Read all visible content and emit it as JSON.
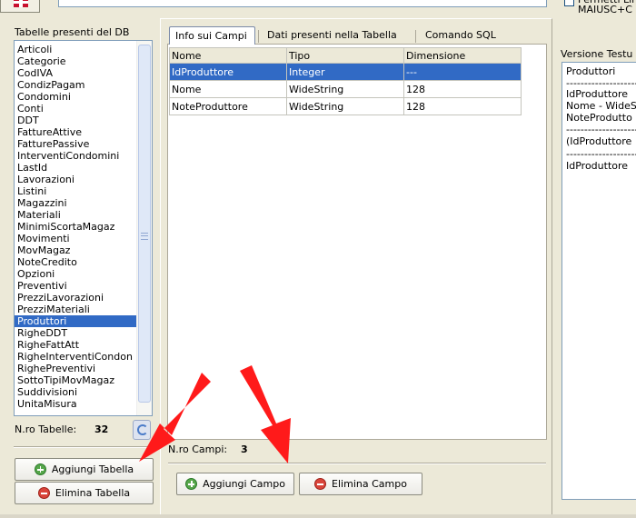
{
  "top": {
    "flag_icon": "uk-flag-icon",
    "perm_label": "Permetti Lin\nMAIUSC+C"
  },
  "tables_panel": {
    "label": "Tabelle presenti del DB",
    "items": [
      "Articoli",
      "Categorie",
      "CodIVA",
      "CondizPagam",
      "Condomini",
      "Conti",
      "DDT",
      "FattureAttive",
      "FatturePassive",
      "InterventiCondomini",
      "LastId",
      "Lavorazioni",
      "Listini",
      "Magazzini",
      "Materiali",
      "MinimiScortaMagaz",
      "Movimenti",
      "MovMagaz",
      "NoteCredito",
      "Opzioni",
      "Preventivi",
      "PrezziLavorazioni",
      "PrezziMateriali",
      "Produttori",
      "RigheDDT",
      "RigheFattAtt",
      "RigheInterventiCondon",
      "RighePreventivi",
      "SottoTipiMovMagaz",
      "Suddivisioni",
      "UnitaMisura"
    ],
    "selected_item": "Produttori",
    "count_label": "N.ro Tabelle:",
    "count_value": "32",
    "add_label": "Aggiungi Tabella",
    "delete_label": "Elimina Tabella"
  },
  "tabs": [
    {
      "label": "Info sui Campi",
      "active": true
    },
    {
      "label": "Dati presenti nella Tabella",
      "active": false
    },
    {
      "label": "Comando SQL",
      "active": false
    }
  ],
  "grid": {
    "columns": [
      "Nome",
      "Tipo",
      "Dimensione"
    ],
    "rows": [
      [
        "IdProduttore",
        "Integer",
        "---"
      ],
      [
        "Nome",
        "WideString",
        "128"
      ],
      [
        "NoteProduttore",
        "WideString",
        "128"
      ]
    ],
    "selected_row": 0
  },
  "fields_panel": {
    "count_label": "N.ro Campi:",
    "count_value": "3",
    "add_label": "Aggiungi Campo",
    "delete_label": "Elimina Campo"
  },
  "version_panel": {
    "label": "Versione Testu",
    "lines": [
      "Produttori",
      "---------------------",
      "IdProduttore",
      "Nome - WideS",
      "NoteProdutto",
      "---------------------",
      "(IdProduttore",
      "---------------------",
      "IdProduttore"
    ]
  },
  "colors": {
    "selection": "#316ac5",
    "window_bg": "#ece9d8",
    "arrow": "#ff1a1a"
  }
}
